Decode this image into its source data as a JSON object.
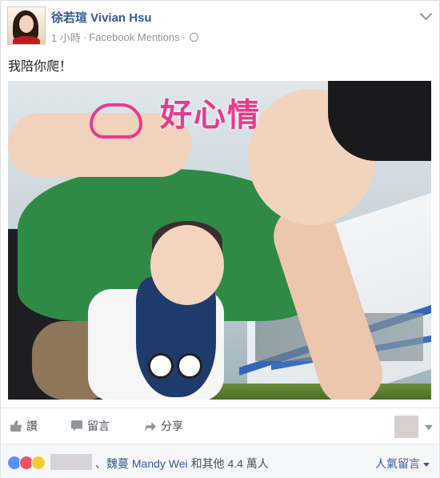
{
  "post": {
    "author_name": "徐若瑄 Vivian Hsu",
    "time": "1 小時",
    "source": "Facebook Mentions",
    "separator": "·",
    "text": "我陪你爬！",
    "photo_sticker_text": "好心情"
  },
  "actions": {
    "like_label": "讚",
    "comment_label": "留言",
    "share_label": "分享"
  },
  "reactions": {
    "types": [
      "like",
      "love",
      "haha"
    ],
    "separator": "、",
    "names": "魏蔓 Mandy Wei",
    "others_text": "和其他 4.4 萬人",
    "sort_label": "人氣留言"
  },
  "colors": {
    "link": "#365899",
    "text": "#1d2129",
    "meta": "#90949c",
    "like_blue": "#5890ff",
    "love_red": "#f25268",
    "haha_yellow": "#f7c73b"
  },
  "icons": [
    "globe-icon",
    "chevron-down-icon",
    "like-icon",
    "comment-icon",
    "share-icon"
  ]
}
